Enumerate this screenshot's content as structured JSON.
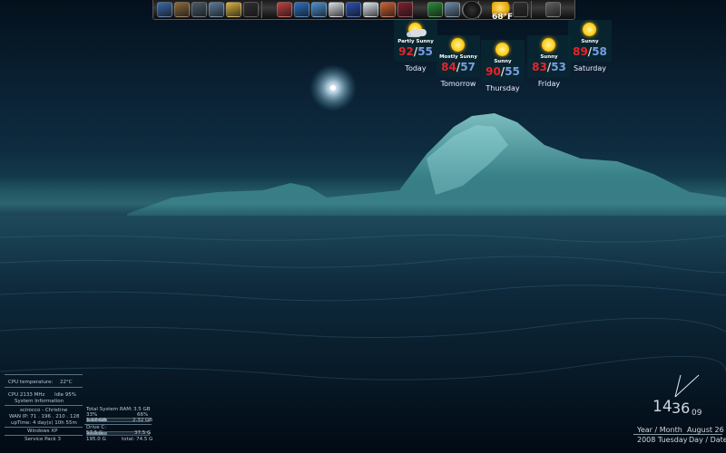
{
  "dock": {
    "icons": [
      "computer-icon",
      "briefcase-icon",
      "recycle-bin-icon",
      "user-icon",
      "folder-icon",
      "clipboard-icon",
      "media-player-icon",
      "browser-icon",
      "player-icon",
      "document-icon",
      "usb-drive-icon",
      "settings-icon",
      "paint-icon",
      "figure-icon",
      "game-icon",
      "gear-icon",
      "clock-gadget-icon",
      "weather-gadget-icon",
      "pen-icon",
      "battery-icon"
    ],
    "weather_temp_overlay": "68°F"
  },
  "weather": [
    {
      "condition": "Partly Sunny",
      "high": "92",
      "low": "55",
      "day": "Today",
      "icon": "partly-sunny-icon"
    },
    {
      "condition": "Mostly Sunny",
      "high": "84",
      "low": "57",
      "day": "Tomorrow",
      "icon": "sun-icon"
    },
    {
      "condition": "Sunny",
      "high": "90",
      "low": "55",
      "day": "Thursday",
      "icon": "sun-icon"
    },
    {
      "condition": "Sunny",
      "high": "83",
      "low": "53",
      "day": "Friday",
      "icon": "sun-icon"
    },
    {
      "condition": "Sunny",
      "high": "89",
      "low": "58",
      "day": "Saturday",
      "icon": "sun-icon"
    }
  ],
  "system": {
    "cpu_temp_label": "CPU temperature:",
    "cpu_temp_value": "22°C",
    "cpu_freq": "CPU 2133 MHz",
    "idle": "Idle 95%",
    "sys_info": "System Information",
    "user": "scirocco - Christine",
    "wan_ip": "WAN IP: 71 . 196 . 210 . 128",
    "uptime": "upTime: 4 day(s) 10h 55m",
    "os": "Windows XP",
    "sp": "Service Pack 3",
    "ram_label": "Total System RAM:",
    "ram_total": "3.5 GB",
    "ram_pct_a": "33%",
    "ram_pct_b": "66%",
    "ram_used": "1.17 GB",
    "ram_free": "2.32 GB",
    "drive_label": "Drive C:",
    "drive_used": "57.5 G",
    "drive_free": "37.5 G",
    "drive_total_left": "195.0 G",
    "drive_total_right": "total: 74.5 G",
    "ram_fill": 0.33,
    "drive_fill": 0.33
  },
  "clock": {
    "hour": "14",
    "minute": "36",
    "seconds": "09",
    "year_month": "Year / Month",
    "date_value": "August 26",
    "year_day": "2008 Tuesday",
    "day_date": "Day / Date"
  }
}
